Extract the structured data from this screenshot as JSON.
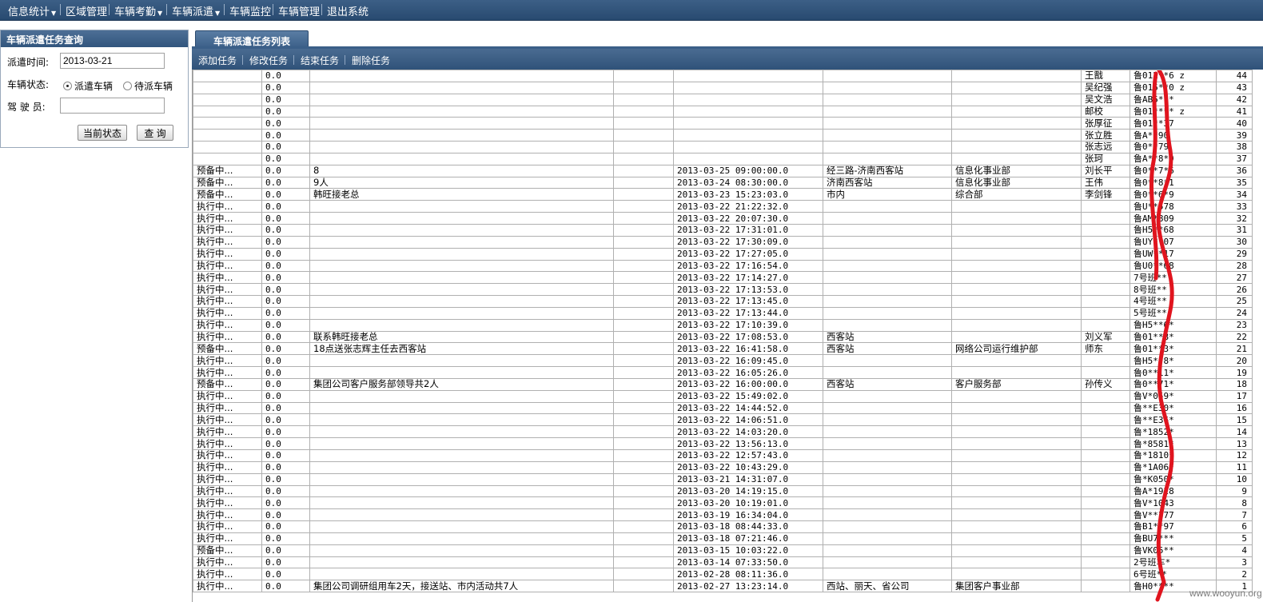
{
  "nav": {
    "items": [
      {
        "label": "信息统计",
        "dropdown": true
      },
      {
        "label": "区域管理",
        "dropdown": false
      },
      {
        "label": "车辆考勤",
        "dropdown": true
      },
      {
        "label": "车辆派遣",
        "dropdown": true
      },
      {
        "label": "车辆监控",
        "dropdown": false
      },
      {
        "label": "车辆管理",
        "dropdown": false
      },
      {
        "label": "退出系统",
        "dropdown": false
      }
    ]
  },
  "query": {
    "title": "车辆派遣任务查询",
    "date_label": "派遣时间:",
    "date_value": "2013-03-21",
    "status_label": "车辆状态:",
    "status_options": [
      "派遣车辆",
      "待派车辆"
    ],
    "status_selected": "派遣车辆",
    "driver_label": "驾 驶 员:",
    "driver_value": "",
    "current_status_button": "当前状态",
    "search_button": "查 询"
  },
  "list": {
    "tab_label": "车辆派遣任务列表",
    "toolbar": [
      "添加任务",
      "修改任务",
      "结束任务",
      "删除任务"
    ],
    "rows": [
      [
        "",
        "0.0",
        "",
        "",
        "",
        "",
        "",
        "王戬",
        "鲁012**6 z",
        "44"
      ],
      [
        "",
        "0.0",
        "",
        "",
        "",
        "",
        "",
        "吴纪强",
        "鲁015**0 z",
        "43"
      ],
      [
        "",
        "0.0",
        "",
        "",
        "",
        "",
        "",
        "吴文浩",
        "鲁AB5***",
        "42"
      ],
      [
        "",
        "0.0",
        "",
        "",
        "",
        "",
        "",
        "邮校",
        "鲁01**** z",
        "41"
      ],
      [
        "",
        "0.0",
        "",
        "",
        "",
        "",
        "",
        "张厚征",
        "鲁01**37",
        "40"
      ],
      [
        "",
        "0.0",
        "",
        "",
        "",
        "",
        "",
        "张立胜",
        "鲁A**90",
        "39"
      ],
      [
        "",
        "0.0",
        "",
        "",
        "",
        "",
        "",
        "张志远",
        "鲁0**79",
        "38"
      ],
      [
        "",
        "0.0",
        "",
        "",
        "",
        "",
        "",
        "张珂",
        "鲁A**8*9",
        "37"
      ],
      [
        "预备中...",
        "0.0",
        "8",
        "",
        "2013-03-25 09:00:00.0",
        "经三路-济南西客站",
        "信息化事业部",
        "刘长平",
        "鲁0**7*6",
        "36"
      ],
      [
        "预备中...",
        "0.0",
        "9人",
        "",
        "2013-03-24 08:30:00.0",
        "济南西客站",
        "信息化事业部",
        "王伟",
        "鲁0**8*1",
        "35"
      ],
      [
        "预备中...",
        "0.0",
        "韩旺接老总",
        "",
        "2013-03-23 15:23:03.0",
        "市内",
        "综合部",
        "李剑锋",
        "鲁0**6*9",
        "34"
      ],
      [
        "执行中...",
        "0.0",
        "",
        "",
        "2013-03-22 21:22:32.0",
        "",
        "",
        "",
        "鲁U**578",
        "33"
      ],
      [
        "执行中...",
        "0.0",
        "",
        "",
        "2013-03-22 20:07:30.0",
        "",
        "",
        "",
        "鲁AM*809",
        "32"
      ],
      [
        "执行中...",
        "0.0",
        "",
        "",
        "2013-03-22 17:31:01.0",
        "",
        "",
        "",
        "鲁H5**68",
        "31"
      ],
      [
        "执行中...",
        "0.0",
        "",
        "",
        "2013-03-22 17:30:09.0",
        "",
        "",
        "",
        "鲁UY**07",
        "30"
      ],
      [
        "执行中...",
        "0.0",
        "",
        "",
        "2013-03-22 17:27:05.0",
        "",
        "",
        "",
        "鲁UW**17",
        "29"
      ],
      [
        "执行中...",
        "0.0",
        "",
        "",
        "2013-03-22 17:16:54.0",
        "",
        "",
        "",
        "鲁U0**68",
        "28"
      ],
      [
        "执行中...",
        "0.0",
        "",
        "",
        "2013-03-22 17:14:27.0",
        "",
        "",
        "",
        "7号班**",
        "27"
      ],
      [
        "执行中...",
        "0.0",
        "",
        "",
        "2013-03-22 17:13:53.0",
        "",
        "",
        "",
        "8号班**",
        "26"
      ],
      [
        "执行中...",
        "0.0",
        "",
        "",
        "2013-03-22 17:13:45.0",
        "",
        "",
        "",
        "4号班**",
        "25"
      ],
      [
        "执行中...",
        "0.0",
        "",
        "",
        "2013-03-22 17:13:44.0",
        "",
        "",
        "",
        "5号班**",
        "24"
      ],
      [
        "执行中...",
        "0.0",
        "",
        "",
        "2013-03-22 17:10:39.0",
        "",
        "",
        "",
        "鲁H5**6*",
        "23"
      ],
      [
        "执行中...",
        "0.0",
        "联系韩旺接老总",
        "",
        "2013-03-22 17:08:53.0",
        "西客站",
        "",
        "刘义军",
        "鲁01**8*",
        "22"
      ],
      [
        "预备中...",
        "0.0",
        "18点送张志辉主任去西客站",
        "",
        "2013-03-22 16:41:58.0",
        "西客站",
        "网络公司运行维护部",
        "师东",
        "鲁01**3*",
        "21"
      ],
      [
        "执行中...",
        "0.0",
        "",
        "",
        "2013-03-22 16:09:45.0",
        "",
        "",
        "",
        "鲁H5**8*",
        "20"
      ],
      [
        "执行中...",
        "0.0",
        "",
        "",
        "2013-03-22 16:05:26.0",
        "",
        "",
        "",
        "鲁0**11*",
        "19"
      ],
      [
        "预备中...",
        "0.0",
        "集团公司客户服务部领导共2人",
        "",
        "2013-03-22 16:00:00.0",
        "西客站",
        "客户服务部",
        "孙传义",
        "鲁0**71*",
        "18"
      ],
      [
        "执行中...",
        "0.0",
        "",
        "",
        "2013-03-22 15:49:02.0",
        "",
        "",
        "",
        "鲁V*059*",
        "17"
      ],
      [
        "执行中...",
        "0.0",
        "",
        "",
        "2013-03-22 14:44:52.0",
        "",
        "",
        "",
        "鲁**E30*",
        "16"
      ],
      [
        "执行中...",
        "0.0",
        "",
        "",
        "2013-03-22 14:06:51.0",
        "",
        "",
        "",
        "鲁**E36*",
        "15"
      ],
      [
        "执行中...",
        "0.0",
        "",
        "",
        "2013-03-22 14:03:20.0",
        "",
        "",
        "",
        "鲁*1852*",
        "14"
      ],
      [
        "执行中...",
        "0.0",
        "",
        "",
        "2013-03-22 13:56:13.0",
        "",
        "",
        "",
        "鲁*8581*",
        "13"
      ],
      [
        "执行中...",
        "0.0",
        "",
        "",
        "2013-03-22 12:57:43.0",
        "",
        "",
        "",
        "鲁*1810*",
        "12"
      ],
      [
        "执行中...",
        "0.0",
        "",
        "",
        "2013-03-22 10:43:29.0",
        "",
        "",
        "",
        "鲁*1A06*",
        "11"
      ],
      [
        "执行中...",
        "0.0",
        "",
        "",
        "2013-03-21 14:31:07.0",
        "",
        "",
        "",
        "鲁*K050*",
        "10"
      ],
      [
        "执行中...",
        "0.0",
        "",
        "",
        "2013-03-20 14:19:15.0",
        "",
        "",
        "",
        "鲁A*1928",
        "9"
      ],
      [
        "执行中...",
        "0.0",
        "",
        "",
        "2013-03-20 10:19:01.0",
        "",
        "",
        "",
        "鲁V*1043",
        "8"
      ],
      [
        "执行中...",
        "0.0",
        "",
        "",
        "2013-03-19 16:34:04.0",
        "",
        "",
        "",
        "鲁V**377",
        "7"
      ],
      [
        "执行中...",
        "0.0",
        "",
        "",
        "2013-03-18 08:44:33.0",
        "",
        "",
        "",
        "鲁B1**97",
        "6"
      ],
      [
        "执行中...",
        "0.0",
        "",
        "",
        "2013-03-18 07:21:46.0",
        "",
        "",
        "",
        "鲁BU7***",
        "5"
      ],
      [
        "预备中...",
        "0.0",
        "",
        "",
        "2013-03-15 10:03:22.0",
        "",
        "",
        "",
        "鲁VK05**",
        "4"
      ],
      [
        "执行中...",
        "0.0",
        "",
        "",
        "2013-03-14 07:33:50.0",
        "",
        "",
        "",
        "2号班车*",
        "3"
      ],
      [
        "执行中...",
        "0.0",
        "",
        "",
        "2013-02-28 08:11:36.0",
        "",
        "",
        "",
        "6号班**",
        "2"
      ],
      [
        "执行中...",
        "0.0",
        "集团公司调研组用车2天，接送站、市内活动共7人",
        "",
        "2013-02-27 13:23:14.0",
        "西站、丽天、省公司",
        "集团客户事业部",
        "",
        "鲁H0****",
        "1"
      ]
    ]
  },
  "annotation_color": "#e0141e",
  "watermark": "www.wooyun.org"
}
